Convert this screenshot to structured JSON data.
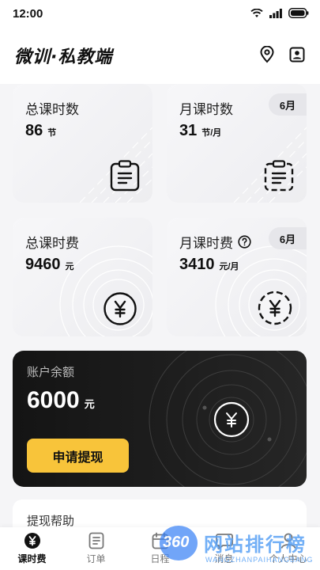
{
  "status_bar": {
    "time": "12:00"
  },
  "header": {
    "brand": "微训·私教端"
  },
  "cards": {
    "total_hours": {
      "title": "总课时数",
      "value": "86",
      "unit": "节"
    },
    "monthly_hours": {
      "title": "月课时数",
      "badge": "6月",
      "value": "31",
      "unit": "节/月"
    },
    "total_fee": {
      "title": "总课时费",
      "value": "9460",
      "unit": "元"
    },
    "monthly_fee": {
      "title": "月课时费",
      "badge": "6月",
      "value": "3410",
      "unit": "元/月"
    }
  },
  "balance": {
    "title": "账户余额",
    "value": "6000",
    "unit": "元",
    "withdraw_label": "申请提现"
  },
  "help": {
    "title": "提现帮助"
  },
  "tabbar": {
    "items": [
      {
        "label": "课时费",
        "icon": "yuan-icon"
      },
      {
        "label": "订单",
        "icon": "order-icon"
      },
      {
        "label": "日程",
        "icon": "calendar-icon"
      },
      {
        "label": "消息",
        "icon": "message-icon"
      },
      {
        "label": "个人中心",
        "icon": "user-icon"
      }
    ]
  },
  "watermark": {
    "badge": "360",
    "text": "网站排行榜",
    "subtext": "WANGZHANPAIHANGBANG"
  },
  "colors": {
    "accent": "#f8c43a",
    "dark": "#1a1a1a",
    "card_bg": "#f0f0f3"
  }
}
